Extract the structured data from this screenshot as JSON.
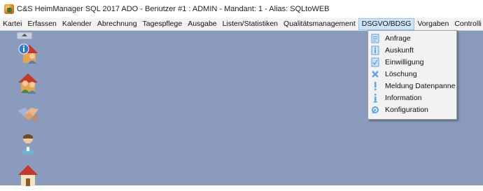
{
  "window": {
    "title": "C&S HeimManager SQL 2017 ADO - Benutzer #1 : ADMIN - Mandant: 1 - Alias: SQLtoWEB"
  },
  "menubar": {
    "items": [
      {
        "label": "Kartei"
      },
      {
        "label": "Erfassen"
      },
      {
        "label": "Kalender"
      },
      {
        "label": "Abrechnung"
      },
      {
        "label": "Tagespflege"
      },
      {
        "label": "Ausgabe"
      },
      {
        "label": "Listen/Statistiken"
      },
      {
        "label": "Qualitätsmanagement"
      },
      {
        "label": "DSGVO/BDSG"
      },
      {
        "label": "Vorgaben"
      },
      {
        "label": "Controlli"
      }
    ],
    "active_label": "DSGVO/BDSG"
  },
  "dsgvo_menu": {
    "items": [
      {
        "label": "Anfrage",
        "icon": "request-icon"
      },
      {
        "label": "Auskunft",
        "icon": "info-sheet-icon"
      },
      {
        "label": "Einwilligung",
        "icon": "consent-icon"
      },
      {
        "label": "Löschung",
        "icon": "delete-icon"
      },
      {
        "label": "Meldung Datenpanne",
        "icon": "exclamation-icon"
      },
      {
        "label": "Information",
        "icon": "information-icon"
      },
      {
        "label": "Konfiguration",
        "icon": "settings-icon"
      }
    ]
  },
  "toolbar": {
    "buttons": [
      {
        "icon": "resident-info-icon"
      },
      {
        "icon": "resident-house-icon"
      },
      {
        "icon": "handshake-icon"
      },
      {
        "icon": "nurse-icon"
      },
      {
        "icon": "house-icon"
      }
    ]
  },
  "colors": {
    "workspace": "#8a9bbd",
    "menu_highlight": "#cce4f7",
    "icon_blue": "#5aa6e6"
  }
}
